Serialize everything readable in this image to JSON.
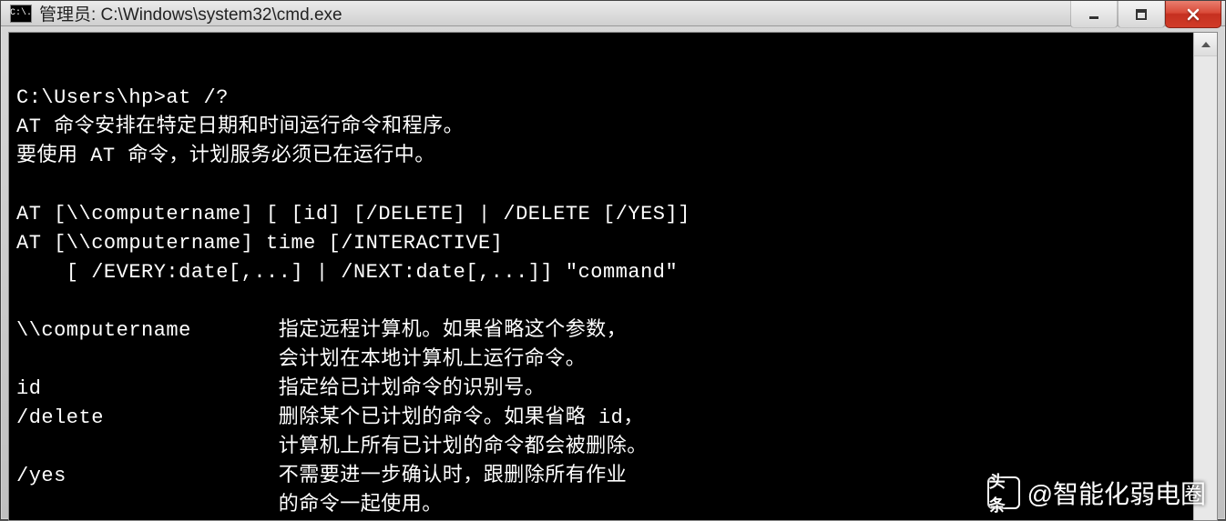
{
  "window": {
    "icon_text": "C:\\.",
    "title": "管理员: C:\\Windows\\system32\\cmd.exe"
  },
  "console": {
    "lines": [
      "",
      "C:\\Users\\hp>at /?",
      "AT 命令安排在特定日期和时间运行命令和程序。",
      "要使用 AT 命令，计划服务必须已在运行中。",
      "",
      "AT [\\\\computername] [ [id] [/DELETE] | /DELETE [/YES]]",
      "AT [\\\\computername] time [/INTERACTIVE]",
      "    [ /EVERY:date[,...] | /NEXT:date[,...]] \"command\"",
      "",
      "\\\\computername       指定远程计算机。如果省略这个参数，",
      "                     会计划在本地计算机上运行命令。",
      "id                   指定给已计划命令的识别号。",
      "/delete              删除某个已计划的命令。如果省略 id，",
      "                     计算机上所有已计划的命令都会被删除。",
      "/yes                 不需要进一步确认时，跟删除所有作业",
      "                     的命令一起使用。"
    ]
  },
  "watermark": {
    "logo": "头条",
    "text": "@智能化弱电圈"
  }
}
